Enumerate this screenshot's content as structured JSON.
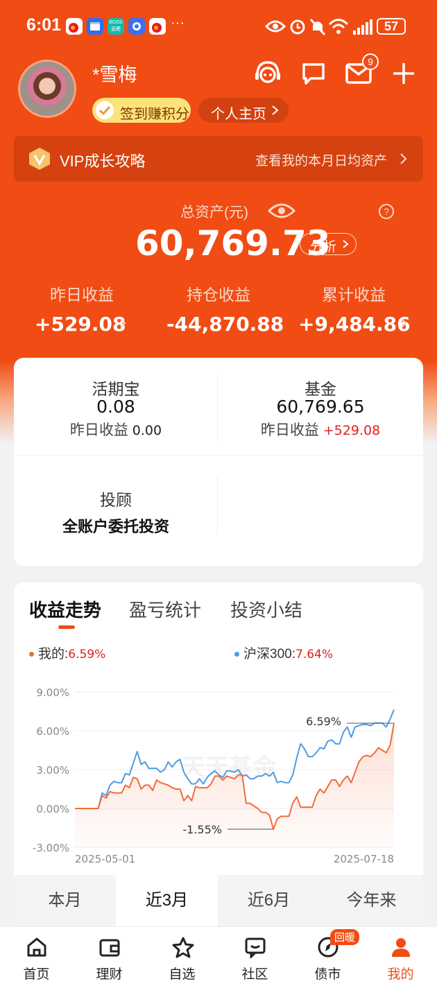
{
  "status": {
    "time": "6:01",
    "battery": "57",
    "dots": "···",
    "boss_badge_top": "BOSS",
    "boss_badge_bottom": "直聘"
  },
  "user": {
    "name": "*雪梅",
    "signin_label": "签到赚积分",
    "profile_label": "个人主页",
    "mail_badge": "9"
  },
  "vip": {
    "title": "VIP成长攻略",
    "link": "查看我的本月日均资产"
  },
  "assets": {
    "total_label": "总资产(元)",
    "total_value": "60,769.73",
    "analyze_label": "分析",
    "help_icon": "?",
    "yesterday_label": "昨日收益",
    "yesterday_value": "+529.08",
    "holding_label": "持仓收益",
    "holding_value": "-44,870.88",
    "cumulative_label": "累计收益",
    "cumulative_value": "+9,484.86"
  },
  "products": {
    "hqb_title": "活期宝",
    "hqb_value": "0.08",
    "hqb_sub_label": "昨日收益",
    "hqb_sub_value": "0.00",
    "fund_title": "基金",
    "fund_value": "60,769.65",
    "fund_sub_label": "昨日收益",
    "fund_sub_value": "+529.08",
    "advisor_title": "投顾",
    "advisor_sub": "全账户委托投资"
  },
  "chart_tabs": [
    "收益走势",
    "盈亏统计",
    "投资小结"
  ],
  "range_tabs": [
    "本月",
    "近3月",
    "近6月",
    "今年来"
  ],
  "watermark": "天天基金",
  "nav": [
    {
      "label": "首页",
      "icon": "home-icon"
    },
    {
      "label": "理财",
      "icon": "wallet-icon"
    },
    {
      "label": "自选",
      "icon": "star-icon"
    },
    {
      "label": "社区",
      "icon": "community-icon"
    },
    {
      "label": "债市",
      "icon": "compass-icon",
      "badge": "回暖"
    },
    {
      "label": "我的",
      "icon": "person-icon"
    }
  ],
  "colors": {
    "brand": "#f04c14",
    "mine": "#f26b3a",
    "index": "#4d9be6",
    "down": "#e02020"
  },
  "chart_data": {
    "type": "line",
    "legend": [
      {
        "name": "我的",
        "value": "6.59%",
        "color": "#f26b3a"
      },
      {
        "name": "沪深300",
        "value": "7.64%",
        "color": "#4d9be6"
      }
    ],
    "ylim": [
      -3,
      9
    ],
    "yticks": [
      "9.00%",
      "6.00%",
      "3.00%",
      "0.00%",
      "-3.00%"
    ],
    "x_start": "2025-05-01",
    "x_end": "2025-07-18",
    "annotations": [
      {
        "text": "6.59%"
      },
      {
        "text": "-1.55%"
      }
    ],
    "series": [
      {
        "name": "我的",
        "color": "#f26b3a",
        "values": [
          0,
          0,
          0,
          0,
          0,
          0,
          0,
          1.0,
          0.8,
          1.3,
          1.2,
          1.2,
          1.2,
          1.8,
          1.6,
          2.4,
          2.3,
          1.5,
          1.8,
          1.8,
          1.4,
          2.2,
          2.0,
          1.9,
          1.8,
          1.6,
          1.5,
          1.5,
          0.6,
          1.0,
          0.6,
          1.7,
          1.6,
          1.6,
          1.6,
          1.9,
          2.5,
          2.5,
          2.2,
          2.5,
          2.4,
          2.3,
          2.6,
          2.6,
          0.4,
          0.4,
          0.2,
          0.0,
          -0.3,
          -0.3,
          -0.5,
          -1.6,
          -0.8,
          -0.6,
          -0.6,
          -0.6,
          0.4,
          0.9,
          0.1,
          0.1,
          0.1,
          0.1,
          1.0,
          1.5,
          1.2,
          1.7,
          2.2,
          2.2,
          1.7,
          2.2,
          2.5,
          2.0,
          2.8,
          3.6,
          4.0,
          4.1,
          4.0,
          4.3,
          4.7,
          4.5,
          4.3,
          4.9,
          6.59
        ]
      },
      {
        "name": "沪深300",
        "color": "#4d9be6",
        "values": [
          0,
          0,
          0,
          0,
          0,
          0,
          0,
          1.2,
          1.0,
          1.8,
          2.1,
          2.0,
          2.0,
          2.7,
          2.6,
          3.5,
          4.4,
          3.4,
          3.6,
          3.1,
          3.1,
          3.1,
          2.8,
          3.0,
          3.6,
          3.2,
          3.6,
          3.8,
          2.8,
          2.3,
          1.9,
          1.9,
          2.3,
          1.9,
          2.4,
          2.7,
          2.9,
          2.6,
          2.4,
          2.9,
          2.9,
          2.8,
          3.0,
          2.5,
          2.6,
          2.3,
          2.3,
          2.5,
          2.5,
          2.7,
          2.5,
          2.8,
          2.0,
          2.1,
          2.0,
          2.0,
          2.6,
          3.9,
          5.0,
          4.6,
          4.0,
          4.0,
          4.3,
          4.7,
          4.6,
          5.2,
          5.3,
          5.0,
          5.0,
          5.9,
          6.3,
          5.5,
          6.3,
          6.4,
          6.5,
          6.5,
          6.4,
          6.6,
          6.6,
          6.6,
          6.3,
          6.9,
          7.64
        ]
      }
    ]
  }
}
